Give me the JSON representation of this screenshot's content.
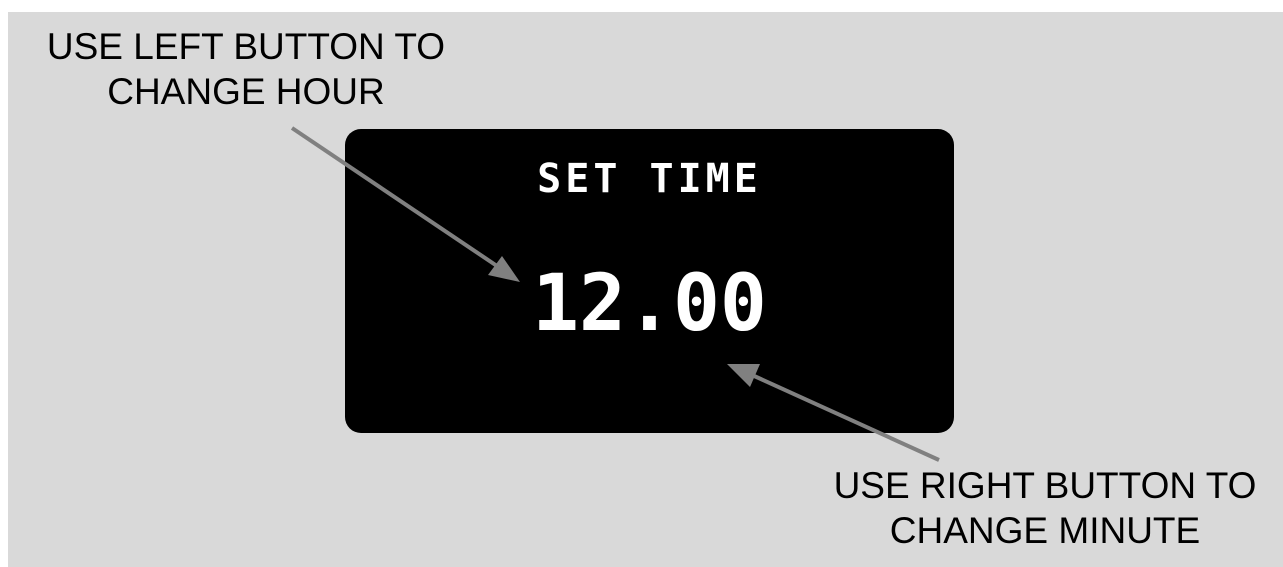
{
  "left_note": {
    "line1": "USE LEFT BUTTON TO",
    "line2": "CHANGE HOUR"
  },
  "right_note": {
    "line1": "USE RIGHT BUTTON TO",
    "line2": "CHANGE MINUTE"
  },
  "display": {
    "title": "SET TIME",
    "time": "12.00"
  },
  "colors": {
    "background": "#d9d9d9",
    "screen": "#000000",
    "screen_text": "#ffffff",
    "arrow": "#808080",
    "annotation_text": "#000000"
  }
}
